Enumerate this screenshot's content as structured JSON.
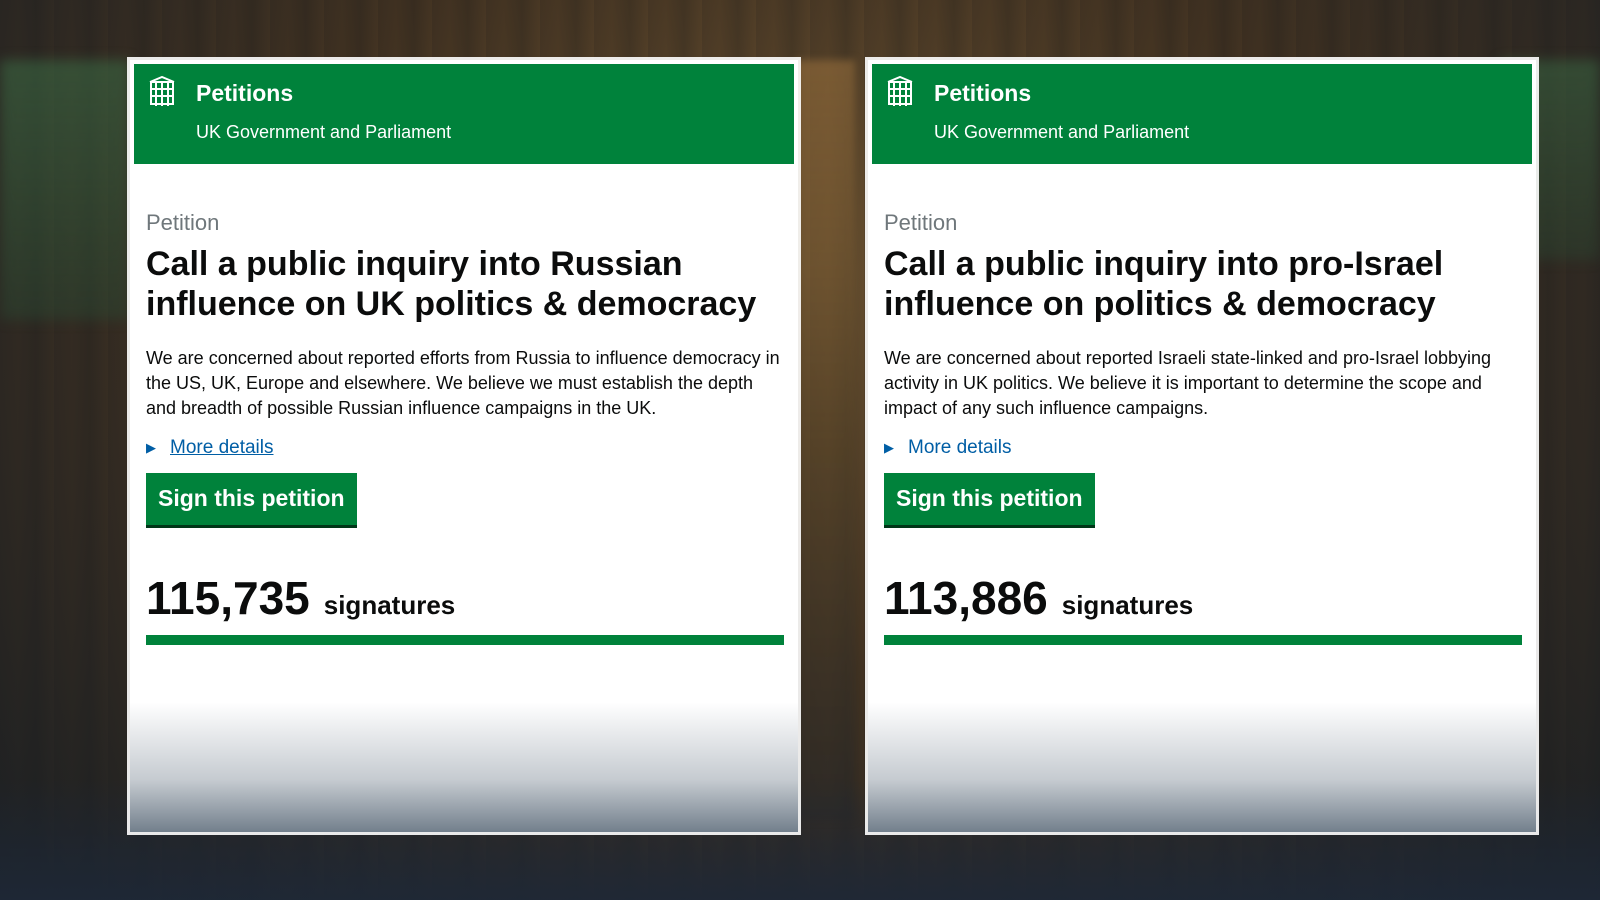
{
  "petitions": [
    {
      "brand_title": "Petitions",
      "brand_subtitle": "UK Government and Parliament",
      "kicker": "Petition",
      "title": "Call a public inquiry into Russian influence on UK politics & democracy",
      "description": "We are concerned about reported efforts from Russia to influence democracy in the US, UK, Europe and elsewhere. We believe we must establish the depth and breadth of possible Russian influence campaigns in the UK.",
      "more_details": "More details",
      "sign_button": "Sign this petition",
      "signature_count": "115,735",
      "signature_label": "signatures",
      "progress_fraction": 1.0
    },
    {
      "brand_title": "Petitions",
      "brand_subtitle": "UK Government and Parliament",
      "kicker": "Petition",
      "title": "Call a public inquiry into pro-Israel influence on politics & democracy",
      "description": "We are concerned about reported Israeli state-linked and pro-Israel lobbying activity in UK politics. We believe it is important to determine the scope and impact of any such influence campaigns.",
      "more_details": "More details",
      "sign_button": "Sign this petition",
      "signature_count": "113,886",
      "signature_label": "signatures",
      "progress_fraction": 1.0
    }
  ],
  "colors": {
    "brand_green": "#00823b",
    "link_blue": "#005ea5",
    "text": "#0b0c0c",
    "muted": "#6f777b"
  },
  "icons": {
    "crest": "portcullis-icon",
    "details": "triangle-right-icon"
  }
}
